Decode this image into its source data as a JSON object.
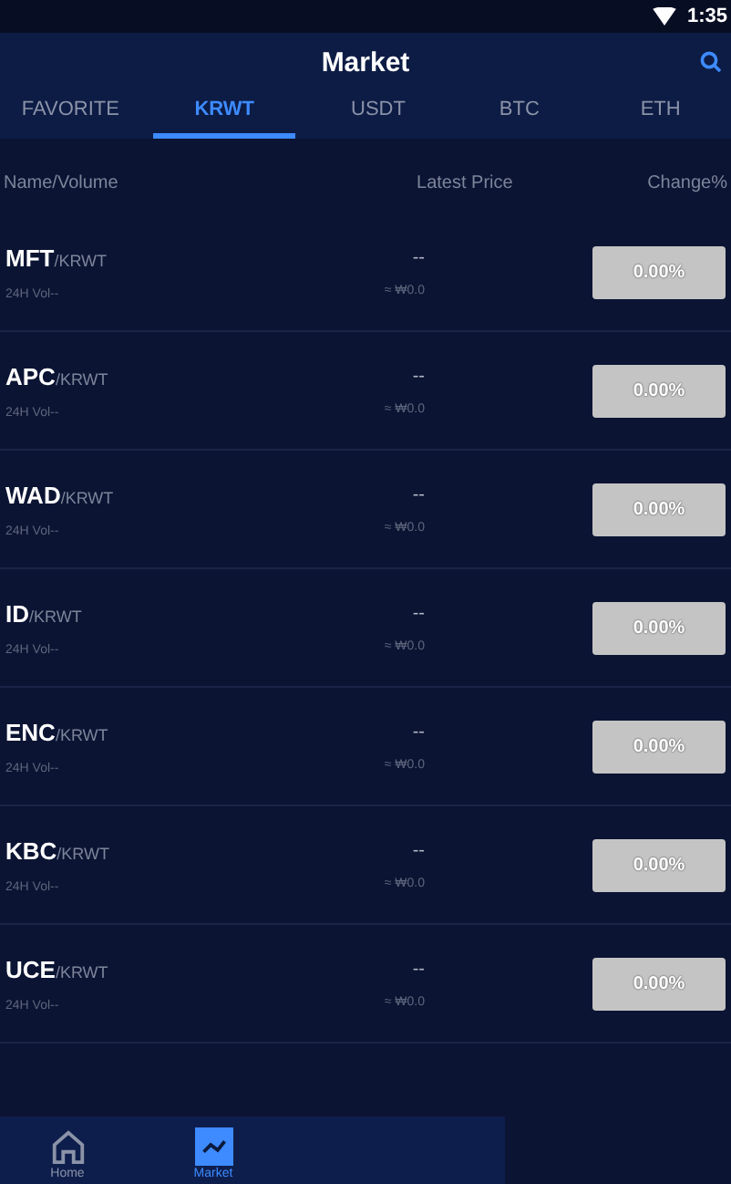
{
  "status_bar": {
    "time": "1:35"
  },
  "header": {
    "title": "Market"
  },
  "tabs": [
    {
      "label": "FAVORITE",
      "selected": false
    },
    {
      "label": "KRWT",
      "selected": true
    },
    {
      "label": "USDT",
      "selected": false
    },
    {
      "label": "BTC",
      "selected": false
    },
    {
      "label": "ETH",
      "selected": false
    }
  ],
  "table": {
    "columns": [
      "Name/Volume",
      "Latest Price",
      "Change%"
    ],
    "rows": [
      {
        "base": "MFT",
        "quote": "/KRWT",
        "volume": "24H Vol--",
        "price": "--",
        "price_krw": "≈ ₩0.0",
        "change": "0.00%"
      },
      {
        "base": "APC",
        "quote": "/KRWT",
        "volume": "24H Vol--",
        "price": "--",
        "price_krw": "≈ ₩0.0",
        "change": "0.00%"
      },
      {
        "base": "WAD",
        "quote": "/KRWT",
        "volume": "24H Vol--",
        "price": "--",
        "price_krw": "≈ ₩0.0",
        "change": "0.00%"
      },
      {
        "base": "ID",
        "quote": "/KRWT",
        "volume": "24H Vol--",
        "price": "--",
        "price_krw": "≈ ₩0.0",
        "change": "0.00%"
      },
      {
        "base": "ENC",
        "quote": "/KRWT",
        "volume": "24H Vol--",
        "price": "--",
        "price_krw": "≈ ₩0.0",
        "change": "0.00%"
      },
      {
        "base": "KBC",
        "quote": "/KRWT",
        "volume": "24H Vol--",
        "price": "--",
        "price_krw": "≈ ₩0.0",
        "change": "0.00%"
      },
      {
        "base": "UCE",
        "quote": "/KRWT",
        "volume": "24H Vol--",
        "price": "--",
        "price_krw": "≈ ₩0.0",
        "change": "0.00%"
      }
    ]
  },
  "bottom_nav": [
    {
      "label": "Home",
      "kind": "home",
      "selected": false
    },
    {
      "label": "Market",
      "kind": "market",
      "selected": true
    }
  ]
}
